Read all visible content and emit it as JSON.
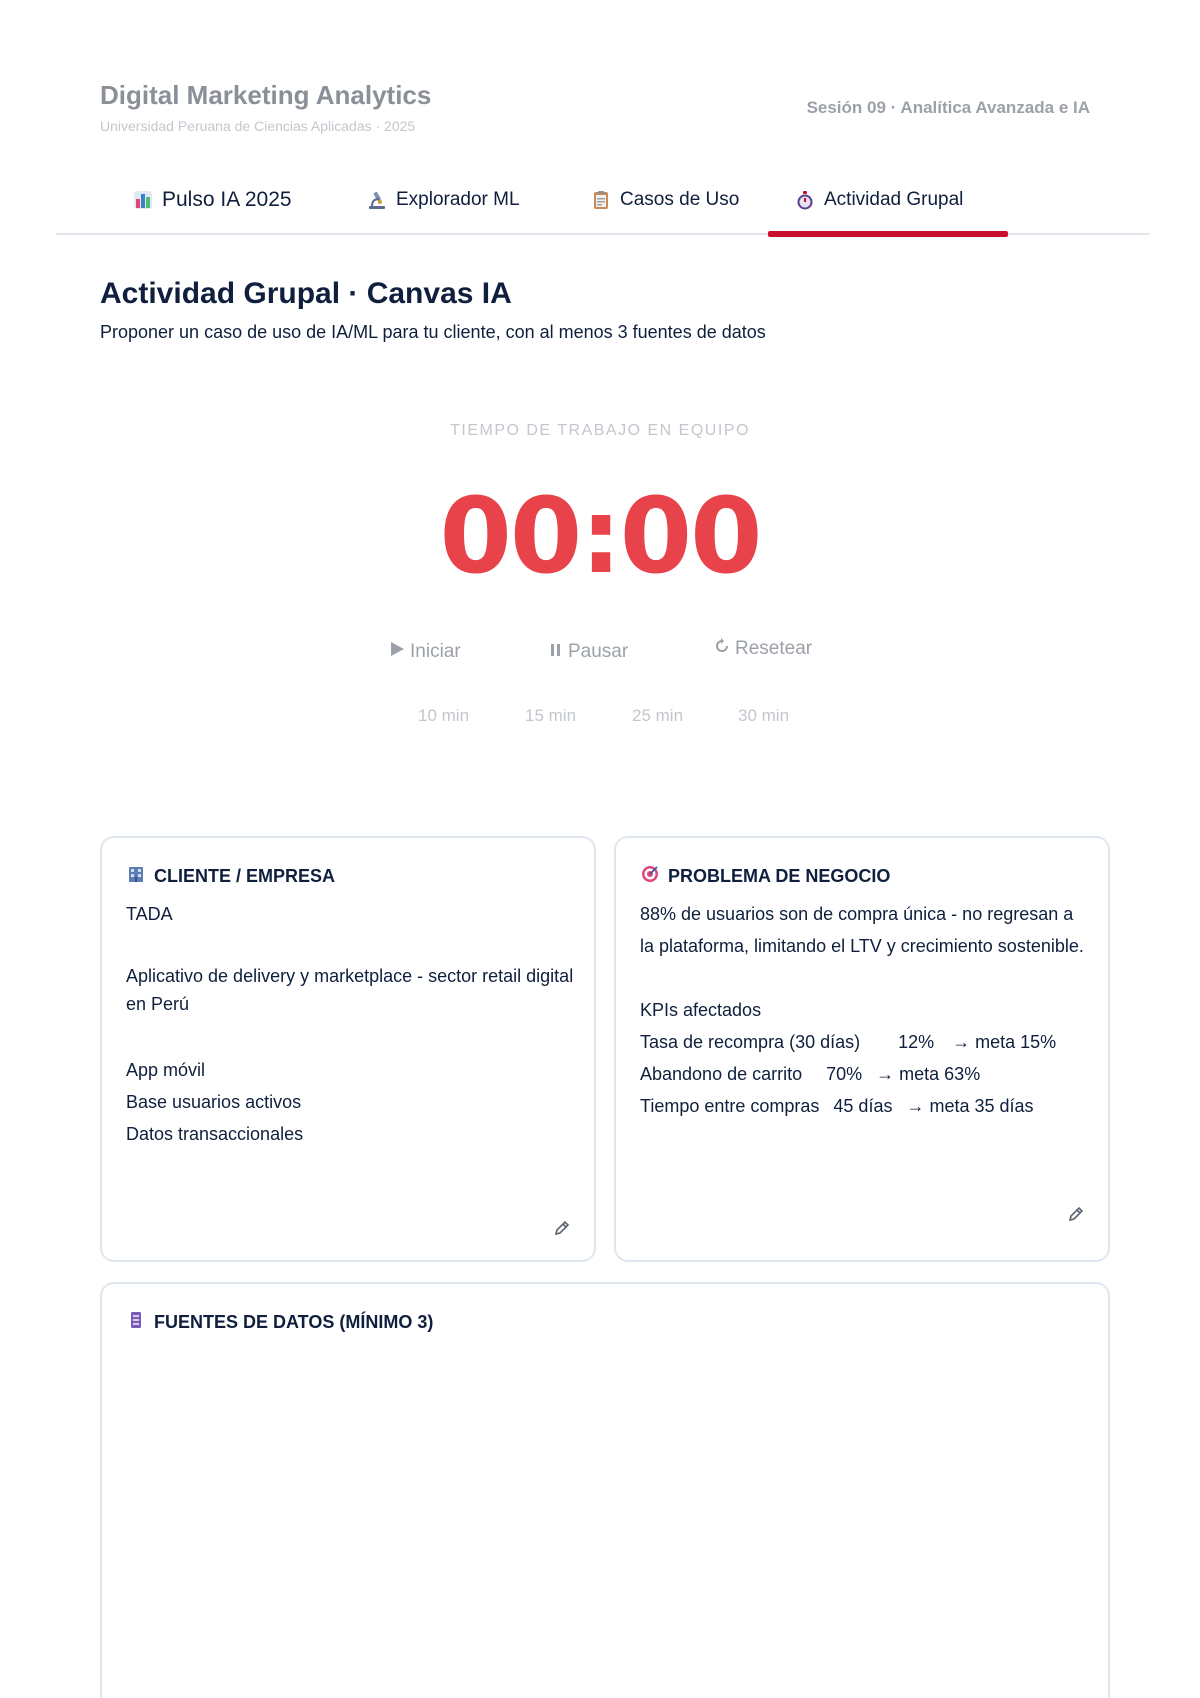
{
  "header": {
    "title": "Digital Marketing Analytics",
    "subtitle": "Universidad Peruana de Ciencias Aplicadas · 2025",
    "session": "Sesión 09 · Analítica Avanzada e IA"
  },
  "tabs": [
    {
      "label": "Pulso IA 2025",
      "icon": "bar-chart-icon"
    },
    {
      "label": "Explorador ML",
      "icon": "microscope-icon"
    },
    {
      "label": "Casos de Uso",
      "icon": "clipboard-icon"
    },
    {
      "label": "Actividad Grupal",
      "icon": "stopwatch-icon",
      "active": true
    }
  ],
  "page": {
    "title": "Actividad Grupal · Canvas IA",
    "subtitle": "Proponer un caso de uso de IA/ML para tu cliente, con al menos 3 fuentes de datos"
  },
  "timer": {
    "label": "TIEMPO DE TRABAJO EN EQUIPO",
    "value": "00:00",
    "controls": {
      "start": "Iniciar",
      "pause": "Pausar",
      "reset": "Resetear"
    },
    "presets": [
      "10 min",
      "15 min",
      "25 min",
      "30 min"
    ]
  },
  "cards": {
    "client": {
      "title": "CLIENTE / EMPRESA",
      "icon": "building-icon",
      "lines": [
        "TADA",
        "",
        "Aplicativo de delivery y marketplace - sector retail digital en Perú",
        "",
        "App móvil",
        "Base usuarios activos",
        "Datos transaccionales"
      ]
    },
    "problem": {
      "title": "PROBLEMA DE NEGOCIO",
      "icon": "target-icon",
      "statement": "88% de usuarios son de compra única - no regresan a la plataforma, limitando el LTV y crecimiento sostenible.",
      "kpi_heading": "KPIs afectados",
      "kpis": [
        {
          "name": "Tasa de recompra (30 días)",
          "value": "12%",
          "target": "→ meta 15%"
        },
        {
          "name": "Abandono de carrito",
          "value": "70%",
          "target": "→ meta 63%"
        },
        {
          "name": "Tiempo entre compras",
          "value": "45 días",
          "target": "→ meta 35 días"
        }
      ]
    },
    "sources": {
      "title": "FUENTES DE DATOS (MÍNIMO 3)",
      "icon": "database-icon"
    }
  },
  "colors": {
    "accent": "#c8102e",
    "timer": "#e8434a",
    "navy": "#0f1f3d",
    "muted": "#9ca1a9"
  }
}
